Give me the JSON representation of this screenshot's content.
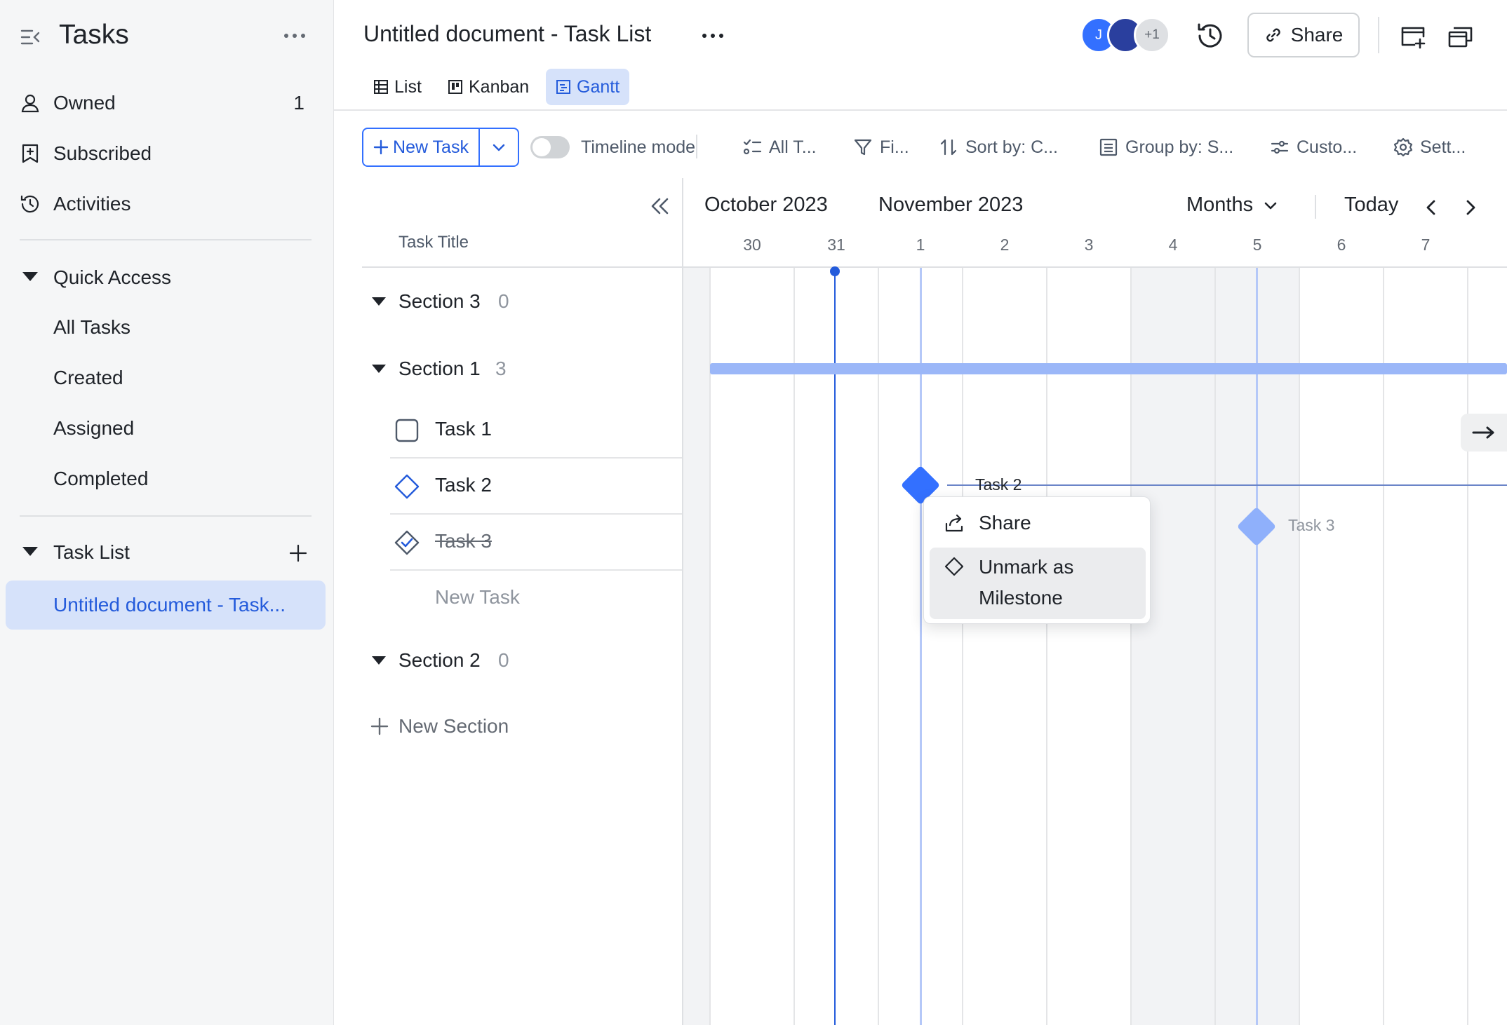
{
  "sidebar": {
    "title": "Tasks",
    "nav": [
      {
        "label": "Owned",
        "count": "1",
        "icon": "user-icon"
      },
      {
        "label": "Subscribed",
        "count": "",
        "icon": "bookmark-icon"
      },
      {
        "label": "Activities",
        "count": "",
        "icon": "history-icon"
      }
    ],
    "quick_access": {
      "label": "Quick Access",
      "items": [
        "All Tasks",
        "Created",
        "Assigned",
        "Completed"
      ]
    },
    "task_list": {
      "label": "Task List",
      "items": [
        "Untitled document - Task..."
      ]
    }
  },
  "header": {
    "title": "Untitled document - Task List",
    "avatars": [
      {
        "initial": "J",
        "color": "#3370ff"
      },
      {
        "initial": "",
        "color": "#2a3f9e"
      },
      {
        "initial": "+1",
        "color": "#dee0e3"
      }
    ],
    "share_label": "Share",
    "tabs": [
      {
        "label": "List",
        "active": false
      },
      {
        "label": "Kanban",
        "active": false
      },
      {
        "label": "Gantt",
        "active": true
      }
    ]
  },
  "toolbar": {
    "new_task": "New Task",
    "timeline_mode": "Timeline mode",
    "timeline_on": false,
    "items": [
      "All T...",
      "Fi...",
      "Sort by: C...",
      "Group by: S...",
      "Custo...",
      "Sett..."
    ]
  },
  "task_pane": {
    "column_header": "Task Title",
    "sections": [
      {
        "name": "Section 3",
        "count": "0"
      },
      {
        "name": "Section 1",
        "count": "3"
      },
      {
        "name": "Section 2",
        "count": "0"
      }
    ],
    "tasks": [
      {
        "title": "Task 1",
        "state": "todo"
      },
      {
        "title": "Task 2",
        "state": "milestone"
      },
      {
        "title": "Task 3",
        "state": "done"
      }
    ],
    "new_task_placeholder": "New Task",
    "new_section": "New Section"
  },
  "gantt": {
    "months": [
      "October 2023",
      "November 2023"
    ],
    "days": [
      "30",
      "31",
      "1",
      "2",
      "3",
      "4",
      "5",
      "6",
      "7"
    ],
    "scale": "Months",
    "today_label": "Today",
    "bars": [
      {
        "label": "Task 2",
        "type": "milestone",
        "day": "1"
      },
      {
        "label": "Task 3",
        "type": "milestone",
        "day": "5"
      }
    ]
  },
  "context_menu": {
    "items": [
      {
        "label": "Share",
        "icon": "share-icon"
      },
      {
        "label": "Unmark as Milestone",
        "label_line1": "Unmark as",
        "label_line2": "Milestone",
        "icon": "diamond-icon"
      }
    ]
  },
  "colors": {
    "accent": "#245bdb",
    "accent_bg": "#d6e2fa",
    "milestone": "#3370ff",
    "milestone_done": "#8fb0fb",
    "section_bar": "#9bb7f8"
  }
}
